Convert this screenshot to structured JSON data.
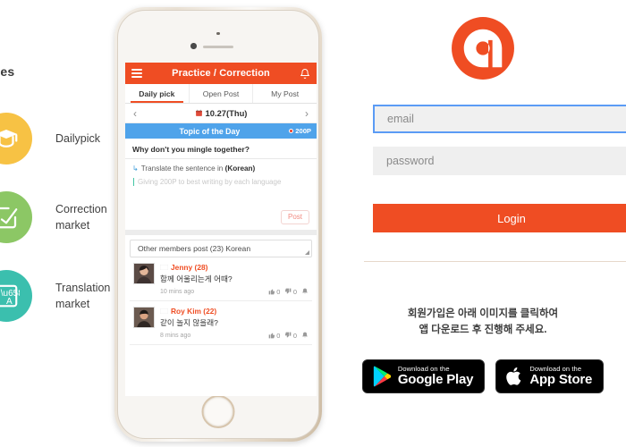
{
  "features": {
    "title": "ures",
    "items": [
      {
        "label": "Dailypick",
        "icon": "graduation-cap-icon",
        "color": "#f7c244"
      },
      {
        "label": "Correction market",
        "icon": "check-pencil-icon",
        "color": "#8cc765"
      },
      {
        "label": "Translation market",
        "icon": "translate-icon",
        "color": "#3bbfae"
      }
    ]
  },
  "phone": {
    "app": {
      "header": {
        "menu_icon": "hamburger-icon",
        "title": "Practice / Correction",
        "bell_icon": "bell-icon"
      },
      "tabs": [
        {
          "label": "Daily pick",
          "active": true
        },
        {
          "label": "Open Post",
          "active": false
        },
        {
          "label": "My Post",
          "active": false
        }
      ],
      "datebar": {
        "prev": "‹",
        "date": "10.27(Thu)",
        "next": "›",
        "calendar_icon": "calendar-icon"
      },
      "topic": {
        "label": "Topic of the Day",
        "points": "200P"
      },
      "question": "Why don't you mingle together?",
      "instruction_prefix": "Translate the sentence in ",
      "instruction_lang": "(Korean)",
      "editor_placeholder": "Giving 200P to best writing by each language",
      "post_button": "Post",
      "others_header": "Other members post (23) Korean",
      "posts": [
        {
          "name": "Jenny (28)",
          "text": "함께 어울리는게 어때?",
          "ago": "10 mins ago",
          "likes": "0",
          "dislikes": "0",
          "flag": "korea-flag-icon",
          "report_icon": "report-icon"
        },
        {
          "name": "Roy Kim (22)",
          "text": "같이 놀지 않을래?",
          "ago": "8 mins ago",
          "likes": "0",
          "dislikes": "0",
          "flag": "korea-flag-icon",
          "report_icon": "report-icon"
        }
      ]
    }
  },
  "login": {
    "logo_icon": "app-logo-icon",
    "email_placeholder": "email",
    "email_value": "",
    "password_placeholder": "password",
    "password_value": "",
    "login_button": "Login",
    "signup_note_line1": "회원가입은 아래 이미지를 클릭하여",
    "signup_note_line2": "앱 다운로드 후 진행해 주세요.",
    "badges": [
      {
        "small": "Download on the",
        "big": "Google Play",
        "icon": "google-play-icon"
      },
      {
        "small": "Download on the",
        "big": "App Store",
        "icon": "apple-icon"
      }
    ]
  },
  "colors": {
    "brand_orange": "#ef4d23",
    "topic_blue": "#4fa3ea",
    "focus_blue": "#5b9bf5"
  }
}
